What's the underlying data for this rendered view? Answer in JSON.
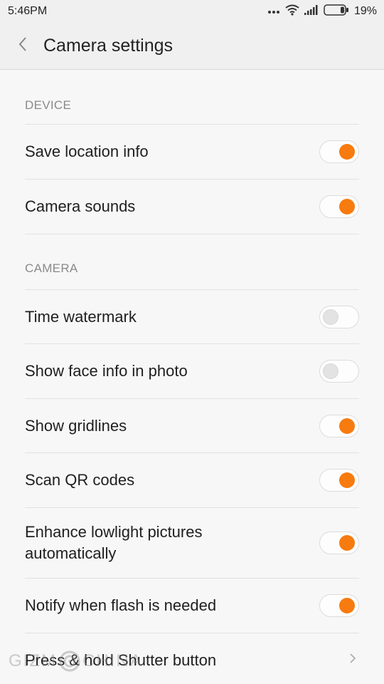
{
  "status_bar": {
    "time": "5:46PM",
    "battery": "19%"
  },
  "header": {
    "title": "Camera settings"
  },
  "sections": [
    {
      "title": "DEVICE",
      "items": [
        {
          "label": "Save location info",
          "on": true
        },
        {
          "label": "Camera sounds",
          "on": true
        }
      ]
    },
    {
      "title": "CAMERA",
      "items": [
        {
          "label": "Time watermark",
          "on": false
        },
        {
          "label": "Show face info in photo",
          "on": false
        },
        {
          "label": "Show gridlines",
          "on": true
        },
        {
          "label": "Scan QR codes",
          "on": true
        },
        {
          "label": "Enhance lowlight pictures",
          "label_line2": "automatically",
          "on": true
        },
        {
          "label": "Notify when flash is needed",
          "on": true
        },
        {
          "label": "Press & hold Shutter button"
        }
      ]
    }
  ],
  "watermark": {
    "text_left": "GIZM",
    "text_right": "CHINA"
  },
  "colors": {
    "accent": "#f77b0f",
    "background": "#f7f7f7"
  },
  "icons": [
    "back-chevron-icon",
    "more-dots-icon",
    "wifi-icon",
    "signal-icon",
    "battery-icon",
    "chevron-right-icon"
  ]
}
